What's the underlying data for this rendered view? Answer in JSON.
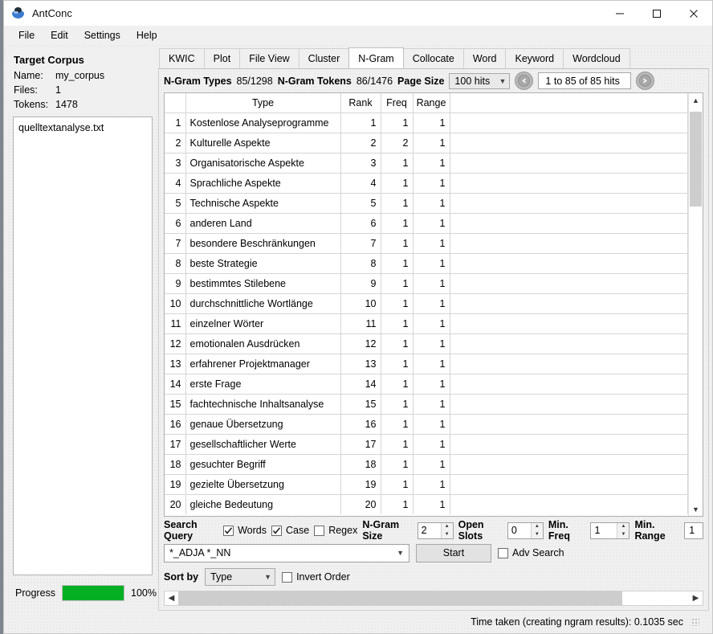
{
  "window": {
    "title": "AntConc",
    "minimize_label": "minimize",
    "maximize_label": "maximize",
    "close_label": "close"
  },
  "menu": {
    "items": [
      "File",
      "Edit",
      "Settings",
      "Help"
    ]
  },
  "sidebar": {
    "title": "Target Corpus",
    "fields": [
      {
        "label": "Name:",
        "value": "my_corpus"
      },
      {
        "label": "Files:",
        "value": "1"
      },
      {
        "label": "Tokens:",
        "value": "1478"
      }
    ],
    "files": [
      "quelltextanalyse.txt"
    ],
    "progress": {
      "label": "Progress",
      "percent_label": "100%",
      "percent": 100,
      "color": "#06b025"
    }
  },
  "tabs": [
    {
      "label": "KWIC",
      "active": false
    },
    {
      "label": "Plot",
      "active": false
    },
    {
      "label": "File View",
      "active": false
    },
    {
      "label": "Cluster",
      "active": false
    },
    {
      "label": "N-Gram",
      "active": true
    },
    {
      "label": "Collocate",
      "active": false
    },
    {
      "label": "Word",
      "active": false
    },
    {
      "label": "Keyword",
      "active": false
    },
    {
      "label": "Wordcloud",
      "active": false
    }
  ],
  "info_bar": {
    "types_label": "N-Gram Types",
    "types_value": "85/1298",
    "tokens_label": "N-Gram Tokens",
    "tokens_value": "86/1476",
    "page_size_label": "Page Size",
    "page_size_value": "100 hits",
    "hits_range": "1 to 85 of 85 hits"
  },
  "table": {
    "columns": [
      "Type",
      "Rank",
      "Freq",
      "Range"
    ],
    "rows": [
      {
        "n": "1",
        "type": "Kostenlose Analyseprogramme",
        "rank": "1",
        "freq": "1",
        "range": "1"
      },
      {
        "n": "2",
        "type": "Kulturelle Aspekte",
        "rank": "2",
        "freq": "2",
        "range": "1"
      },
      {
        "n": "3",
        "type": "Organisatorische Aspekte",
        "rank": "3",
        "freq": "1",
        "range": "1"
      },
      {
        "n": "4",
        "type": "Sprachliche Aspekte",
        "rank": "4",
        "freq": "1",
        "range": "1"
      },
      {
        "n": "5",
        "type": "Technische Aspekte",
        "rank": "5",
        "freq": "1",
        "range": "1"
      },
      {
        "n": "6",
        "type": "anderen Land",
        "rank": "6",
        "freq": "1",
        "range": "1"
      },
      {
        "n": "7",
        "type": "besondere Beschränkungen",
        "rank": "7",
        "freq": "1",
        "range": "1"
      },
      {
        "n": "8",
        "type": "beste Strategie",
        "rank": "8",
        "freq": "1",
        "range": "1"
      },
      {
        "n": "9",
        "type": "bestimmtes Stilebene",
        "rank": "9",
        "freq": "1",
        "range": "1"
      },
      {
        "n": "10",
        "type": "durchschnittliche Wortlänge",
        "rank": "10",
        "freq": "1",
        "range": "1"
      },
      {
        "n": "11",
        "type": "einzelner Wörter",
        "rank": "11",
        "freq": "1",
        "range": "1"
      },
      {
        "n": "12",
        "type": "emotionalen Ausdrücken",
        "rank": "12",
        "freq": "1",
        "range": "1"
      },
      {
        "n": "13",
        "type": "erfahrener Projektmanager",
        "rank": "13",
        "freq": "1",
        "range": "1"
      },
      {
        "n": "14",
        "type": "erste Frage",
        "rank": "14",
        "freq": "1",
        "range": "1"
      },
      {
        "n": "15",
        "type": "fachtechnische Inhaltsanalyse",
        "rank": "15",
        "freq": "1",
        "range": "1"
      },
      {
        "n": "16",
        "type": "genaue Übersetzung",
        "rank": "16",
        "freq": "1",
        "range": "1"
      },
      {
        "n": "17",
        "type": "gesellschaftlicher Werte",
        "rank": "17",
        "freq": "1",
        "range": "1"
      },
      {
        "n": "18",
        "type": "gesuchter Begriff",
        "rank": "18",
        "freq": "1",
        "range": "1"
      },
      {
        "n": "19",
        "type": "gezielte Übersetzung",
        "rank": "19",
        "freq": "1",
        "range": "1"
      },
      {
        "n": "20",
        "type": "gleiche Bedeutung",
        "rank": "20",
        "freq": "1",
        "range": "1"
      }
    ]
  },
  "search": {
    "label": "Search Query",
    "words": {
      "label": "Words",
      "checked": true
    },
    "case": {
      "label": "Case",
      "checked": true
    },
    "regex": {
      "label": "Regex",
      "checked": false
    },
    "ngram_size": {
      "label": "N-Gram Size",
      "value": "2"
    },
    "open_slots": {
      "label": "Open Slots",
      "value": "0"
    },
    "min_freq": {
      "label": "Min. Freq",
      "value": "1"
    },
    "min_range": {
      "label": "Min. Range",
      "value": "1"
    },
    "query_value": "*_ADJA *_NN",
    "start_label": "Start",
    "adv_search": {
      "label": "Adv Search",
      "checked": false
    }
  },
  "sort": {
    "label": "Sort by",
    "value": "Type",
    "invert": {
      "label": "Invert Order",
      "checked": false
    }
  },
  "status": {
    "text": "Time taken (creating ngram results):  0.1035 sec"
  }
}
